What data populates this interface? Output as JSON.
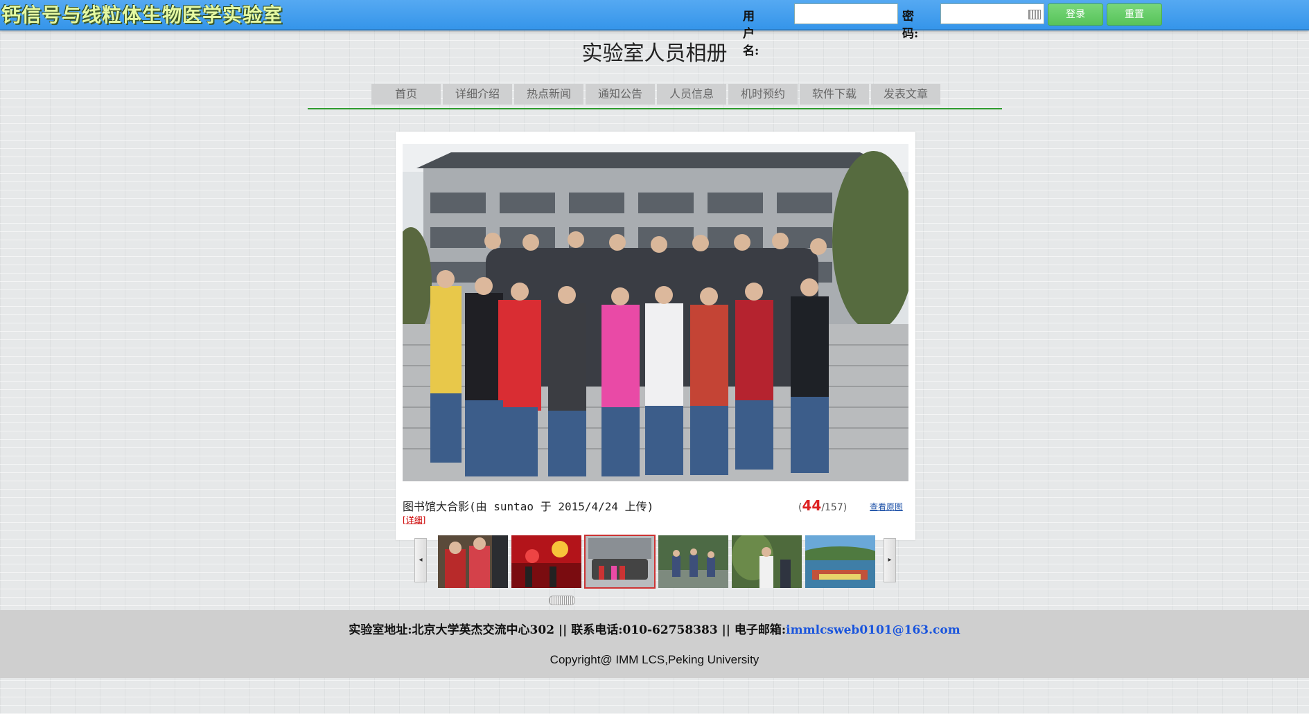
{
  "header": {
    "site_title": "钙信号与线粒体生物医学实验室",
    "username_label": "用户名:",
    "username_value": "",
    "password_label": "密码:",
    "password_value": "",
    "login_button": "登录",
    "reset_button": "重置",
    "accent_color": "#3a99ec",
    "button_color": "#5fc862"
  },
  "page_title": "实验室人员相册",
  "nav": {
    "items": [
      "首页",
      "详细介绍",
      "热点新闻",
      "通知公告",
      "人员信息",
      "机时预约",
      "软件下载",
      "发表文章"
    ],
    "underline_color": "#2e9b2e"
  },
  "album": {
    "caption": "图书馆大合影(由 suntao 于 2015/4/24 上传)",
    "detail_link": "[详细]",
    "current_index": "44",
    "total_count": "/157",
    "counter_open": "(",
    "counter_close": ")",
    "view_original": "查看原图",
    "prev_icon": "◂",
    "next_icon": "▸",
    "thumbnails": [
      "thumb-1",
      "thumb-2",
      "thumb-3-selected",
      "thumb-4",
      "thumb-5",
      "thumb-6"
    ]
  },
  "footer": {
    "contact_text": "实验室地址:北京大学英杰交流中心302 || 联系电话:010-62758383 || 电子邮箱:",
    "email": "immlcsweb0101@163.com",
    "copyright": "Copyright@ IMM LCS,Peking University"
  }
}
